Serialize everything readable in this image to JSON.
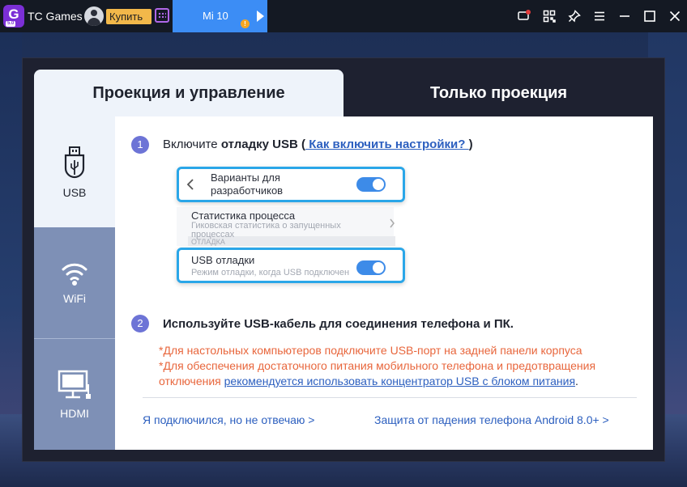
{
  "titlebar": {
    "app_name": "TC Games",
    "logo_letter": "G",
    "logo_version": "5.0",
    "buy_label": "Купить",
    "device_tab": "Mi 10",
    "warning_mark": "!",
    "icons": [
      "calendar-icon",
      "message-icon",
      "qr-code-icon",
      "pin-icon",
      "menu-icon",
      "minimize-icon",
      "maximize-icon",
      "close-icon"
    ]
  },
  "dialog": {
    "tabs": [
      "Проекция и управление",
      "Только проекция"
    ],
    "sidebar": [
      {
        "label": "USB",
        "icon": "usb-icon"
      },
      {
        "label": "WiFi",
        "icon": "wifi-icon"
      },
      {
        "label": "HDMI",
        "icon": "hdmi-monitor-icon"
      }
    ],
    "step1": {
      "number": "1",
      "prefix": "Включите ",
      "bold": "отладку USB",
      "paren_open": " (",
      "link": " Как включить настройки? ",
      "paren_close": ")"
    },
    "illustration": {
      "dev_options": "Варианты для разработчиков",
      "process_stats_title": "Статистика процесса",
      "process_stats_sub": "Гиковская статистика о запущенных процессах",
      "section": "ОТЛАДКА",
      "usb_debug_title": "USB отладки",
      "usb_debug_sub": "Режим отладки, когда USB подключен"
    },
    "step2": {
      "number": "2",
      "text": "Используйте USB-кабель для соединения телефона и ПК."
    },
    "notes": {
      "line1": "*Для настольных компьютеров подключите USB-порт на задней панели корпуса",
      "line2_prefix": "*Для обеспечения достаточного питания мобильного телефона и предотвращения отключения ",
      "line2_link": "рекомендуется использовать концентратор USB с блоком питания",
      "line2_end": "."
    },
    "bottom_links": {
      "not_responding": "Я подключился, но не отвечаю >",
      "android_protection": "Защита от падения телефона Android 8.0+ >"
    }
  },
  "colors": {
    "accent_blue": "#3c8df5",
    "highlight_border": "#2aa6e8",
    "warning_text": "#e8663c",
    "link": "#2c5fbf",
    "step_badge": "#6d74d6",
    "sidebar": "#7e90b6"
  }
}
